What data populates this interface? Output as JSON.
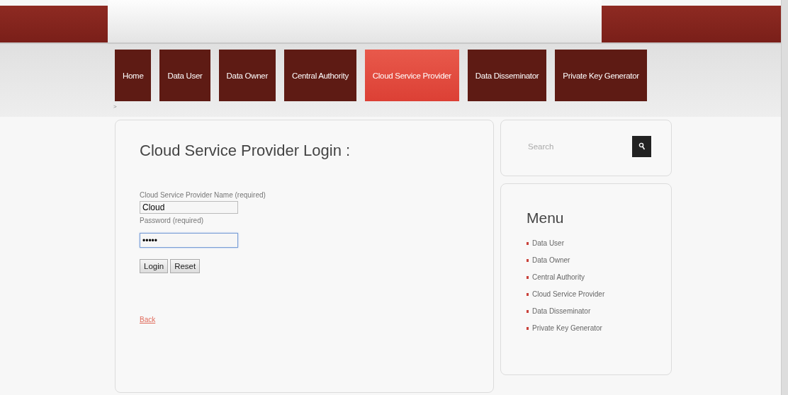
{
  "nav": {
    "tabs": [
      {
        "label": "Home",
        "selected": false
      },
      {
        "label": "Data User",
        "selected": false
      },
      {
        "label": "Data Owner",
        "selected": false
      },
      {
        "label": "Central Authority",
        "selected": false
      },
      {
        "label": "Cloud Service Provider",
        "selected": true
      },
      {
        "label": "Data Disseminator",
        "selected": false
      },
      {
        "label": "Private Key Generator",
        "selected": false
      }
    ]
  },
  "breadcrumb": ">",
  "login": {
    "title": "Cloud Service Provider Login :",
    "fields": [
      {
        "label": "Cloud Service Provider Name (required)",
        "value": "Cloud",
        "focused": false
      },
      {
        "label": "Password (required)",
        "value": "•••••",
        "focused": true
      }
    ],
    "buttons": [
      "Login",
      "Reset"
    ],
    "back_link": "Back"
  },
  "search": {
    "placeholder": "Search"
  },
  "menu": {
    "title": "Menu",
    "items": [
      "Data User",
      "Data Owner",
      "Central Authority",
      "Cloud Service Provider",
      "Data Disseminator",
      "Private Key Generator"
    ]
  }
}
